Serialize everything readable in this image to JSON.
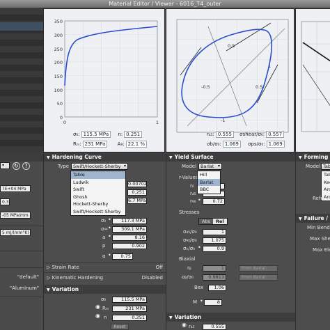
{
  "window": {
    "title": "Material Editor / Viewer - 6016_T4_outer"
  },
  "left": {
    "fields": [
      "7E+04 MPa",
      "0.3",
      "-05 MPa/mm",
      "5 mJ/(mm°K)"
    ],
    "string_a": "\"default\"",
    "string_b": "\"Aluminum\"",
    "help": "?",
    "combo_arrow": "▾"
  },
  "plots": {
    "hardening": {
      "y_ticks": [
        "350",
        "300",
        "250",
        "200",
        "150",
        "100",
        "50",
        "0"
      ],
      "x_ticks": [
        "0",
        "1"
      ],
      "sigma0_label": "σ₀:",
      "sigma0": "115.5 MPa",
      "n_label": "n:",
      "n": "0.251",
      "rm_label": "Rₘ:",
      "rm": "231 MPa",
      "ag_label": "A₉:",
      "ag": "22.1 %"
    },
    "yield": {
      "ticks": [
        "0.5",
        "-0.5",
        "-1",
        "1",
        "0.5"
      ],
      "r45_label": "r₄₅:",
      "r45": "0.555",
      "shear_label": "σshear/σ₀:",
      "shear": "0.557",
      "sb_label": "σb/σ₀:",
      "sb": "1.069",
      "ps_label": "σps/σ₀:",
      "ps": "1.069"
    }
  },
  "hardening": {
    "header": "Hardening Curve",
    "type_label": "Type",
    "type_value": "Swift/Hockett-Sherby",
    "options": [
      "Table",
      "Ludwik",
      "Swift",
      "Ghosh",
      "Hockett-Sherby",
      "Swift/Hockett-Sherby"
    ],
    "selected_option": 0,
    "right_values": [
      "0.00702",
      "0.251",
      "6.7 MPa"
    ],
    "params": [
      {
        "label": "σ₀",
        "value": "117.3 MPa"
      },
      {
        "label": "σ∞",
        "value": "309.1 MPa"
      },
      {
        "label": "a",
        "value": "8.16"
      },
      {
        "label": "p",
        "value": "0.902"
      },
      {
        "label": "α",
        "value": "0.75"
      }
    ],
    "strain_rate_label": "Strain Rate",
    "strain_rate_value": "Off",
    "kinematic_label": "Kinematic Hardening",
    "kinematic_value": "Disabled"
  },
  "variation": {
    "header": "Variation",
    "params": [
      {
        "label": "σ₀",
        "value": "115.5 MPa"
      },
      {
        "label": "Rₘ",
        "value": "231 MPa"
      },
      {
        "label": "n",
        "value": "0.251"
      }
    ],
    "button": "Reset"
  },
  "yield_surface": {
    "header": "Yield Surface",
    "model_label": "Model",
    "model_value": "Barlat",
    "options": [
      "Hill",
      "Barlat",
      "BBC"
    ],
    "selected_option": 1,
    "rvalues_label": "r-Values",
    "r_rows": [
      {
        "label": "r₀",
        "value": ""
      },
      {
        "label": "r₄₅",
        "value": ""
      },
      {
        "label": "r₉₀",
        "value": "0.72"
      }
    ],
    "stresses_label": "Stresses",
    "abs_label": "Abs",
    "rel_label": "Rel",
    "stress_rows": [
      {
        "label": "σ₄₅/σ₀",
        "value": "1"
      },
      {
        "label": "σ₉₀/σ₀",
        "value": "1.075"
      },
      {
        "label": "σₑ/σ₀",
        "value": "0.9"
      }
    ],
    "biaxial_label": "Biaxial",
    "biaxial_rows": [
      {
        "label": "rᵦ",
        "value": "1",
        "from": "From Barlat"
      },
      {
        "label": "σᵦ/σ₀",
        "value": "0.9813",
        "from": "From Barlat"
      }
    ],
    "bex_label": "Bex",
    "bex_value": "1.06",
    "m_label": "M",
    "m_value": "8"
  },
  "yield_variation": {
    "header": "Variation",
    "r_label": "r₄₅",
    "r_value": "0.555"
  },
  "forming": {
    "header": "Forming Li",
    "model_label": "Model",
    "model_value": "Tab",
    "options": [
      "Table",
      "Keel",
      "Arce",
      "Arce"
    ],
    "ref_label": "Refe",
    "failure_header": "Failure /",
    "min_bend_label": "Min Bendi",
    "max_shear_label": "Max Shea",
    "max_elem_label": "Max Ele"
  }
}
